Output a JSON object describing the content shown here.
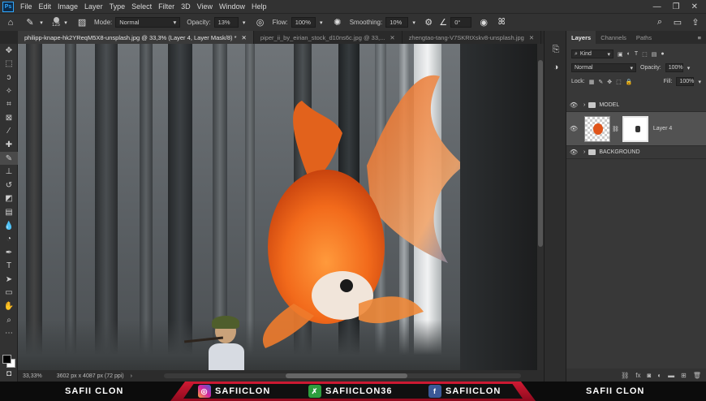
{
  "menubar": {
    "logo": "Ps",
    "items": [
      "File",
      "Edit",
      "Image",
      "Layer",
      "Type",
      "Select",
      "Filter",
      "3D",
      "View",
      "Window",
      "Help"
    ],
    "window_controls": [
      "—",
      "❐",
      "✕"
    ]
  },
  "options": {
    "brush_size": "125",
    "mode_label": "Mode:",
    "mode_value": "Normal",
    "opacity_label": "Opacity:",
    "opacity_value": "13%",
    "flow_label": "Flow:",
    "flow_value": "100%",
    "smoothing_label": "Smoothing:",
    "smoothing_value": "10%",
    "angle_value": "0°"
  },
  "tabs": [
    {
      "label": "philipp-knape-hk2YReqM5X8-unsplash.jpg @ 33,3% (Layer 4, Layer Mask/8) *"
    },
    {
      "label": "piper_ii_by_eirian_stock_d10ns6c.jpg @ 33,..."
    },
    {
      "label": "zhengtao-tang-V7SKRtXskv8-unsplash.jpg"
    }
  ],
  "status": {
    "zoom": "33,33%",
    "doc_info": "3602 px x 4087 px (72 ppi)"
  },
  "layers_panel": {
    "tabs": [
      "Layers",
      "Channels",
      "Paths"
    ],
    "filter_kind": "Kind",
    "blend_mode": "Normal",
    "opacity_label": "Opacity:",
    "opacity_value": "100%",
    "lock_label": "Lock:",
    "fill_label": "Fill:",
    "fill_value": "100%",
    "layers": [
      {
        "name": "MODEL"
      },
      {
        "name": "Layer 4"
      },
      {
        "name": "BACKGROUND"
      }
    ]
  },
  "banner": {
    "left_name": "SAFII CLON",
    "instagram": "SAFIICLON",
    "other": "SAFIICLON36",
    "facebook": "SAFIICLON",
    "right_name": "SAFII CLON"
  },
  "colors": {
    "accent": "#31a8ff",
    "banner_red": "#c8102e",
    "fish_orange": "#f26a1b"
  }
}
